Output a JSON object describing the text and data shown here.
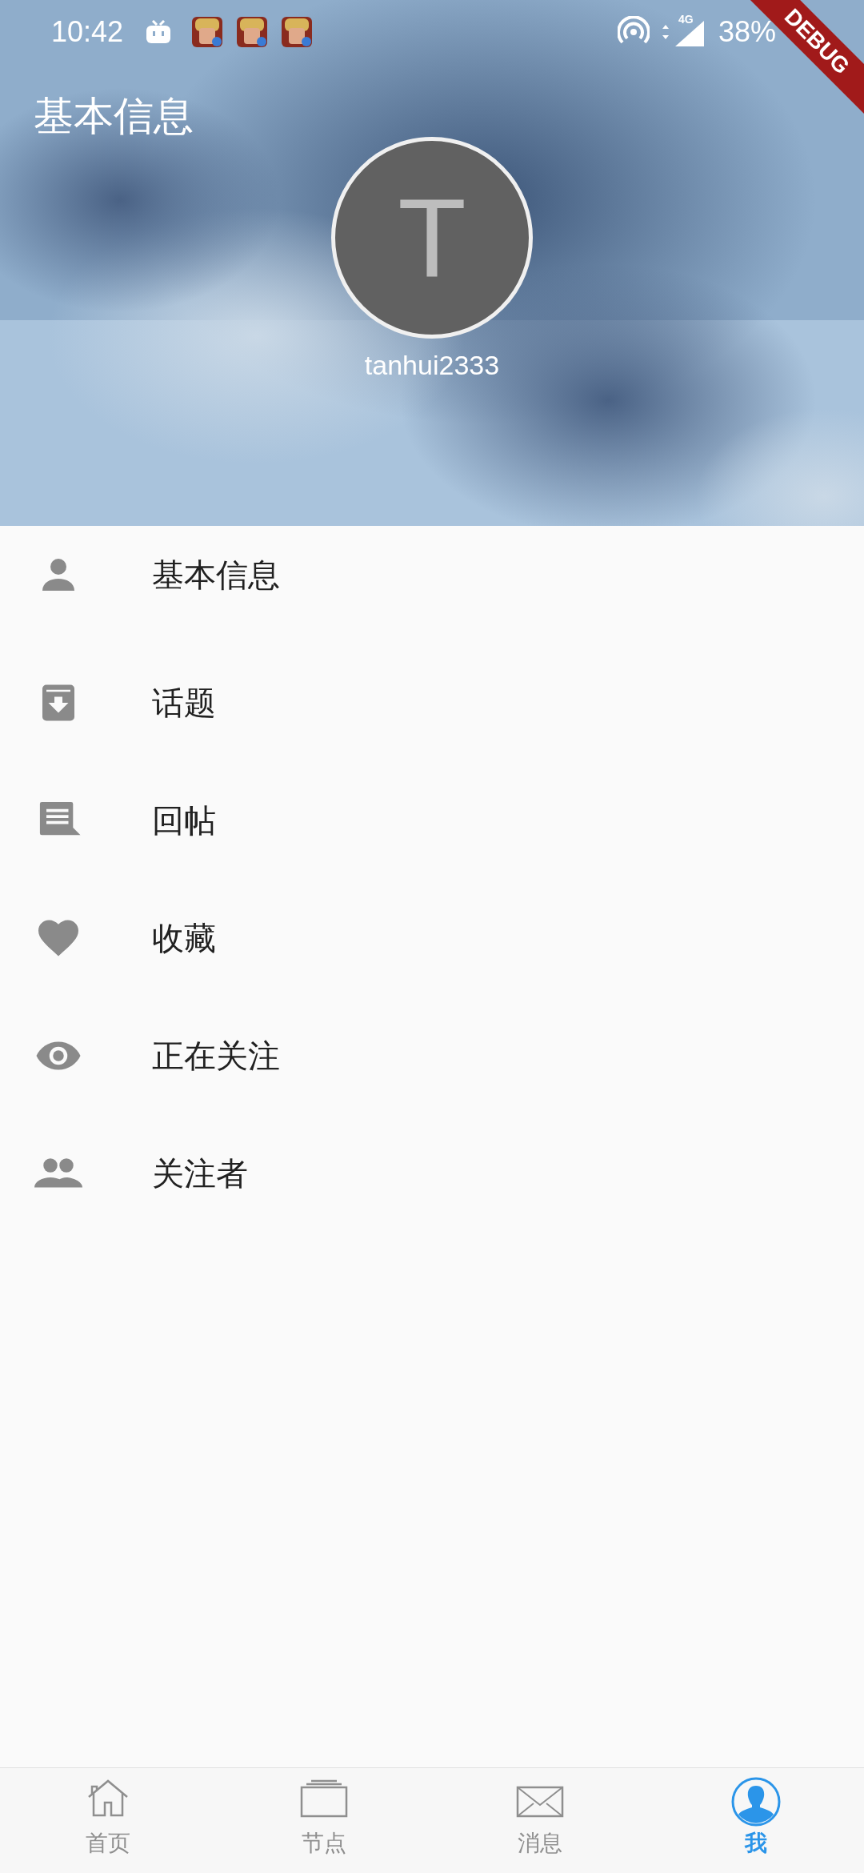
{
  "status_bar": {
    "time": "10:42",
    "network": "4G",
    "battery": "38%"
  },
  "debug_banner": "DEBUG",
  "header": {
    "title": "基本信息",
    "avatar_letter": "T",
    "username": "tanhui2333"
  },
  "menu": [
    {
      "label": "基本信息"
    },
    {
      "label": "话题"
    },
    {
      "label": "回帖"
    },
    {
      "label": "收藏"
    },
    {
      "label": "正在关注"
    },
    {
      "label": "关注者"
    }
  ],
  "bottom_nav": [
    {
      "label": "首页",
      "selected": false
    },
    {
      "label": "节点",
      "selected": false
    },
    {
      "label": "消息",
      "selected": false
    },
    {
      "label": "我",
      "selected": true
    }
  ]
}
